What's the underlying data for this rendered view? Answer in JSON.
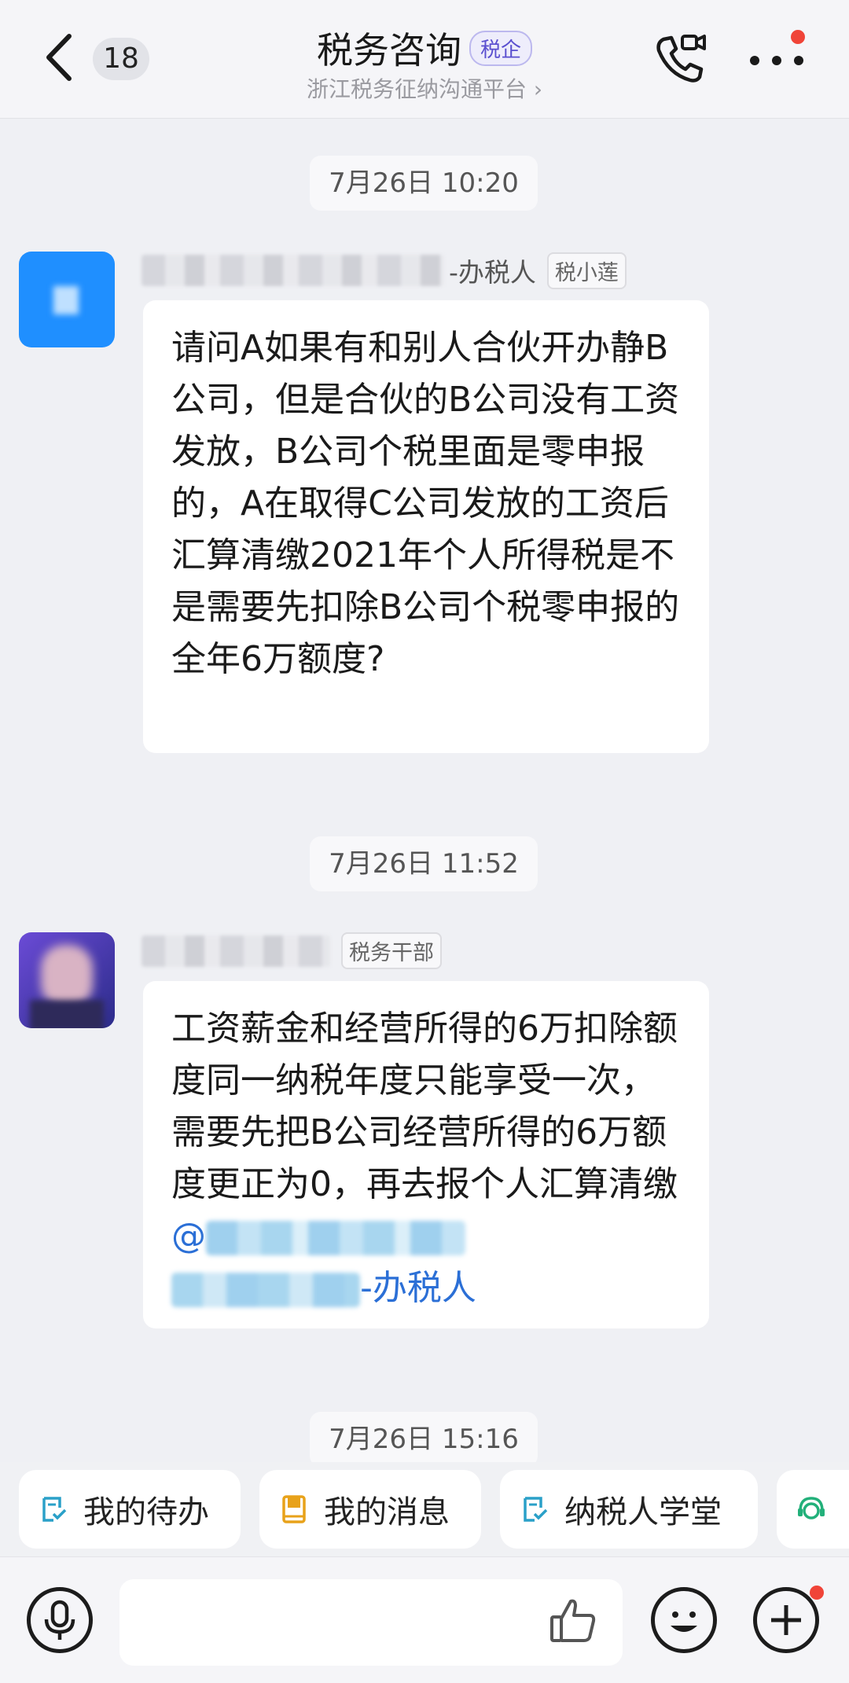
{
  "header": {
    "unread_count": "18",
    "title": "税务咨询",
    "title_badge": "税企",
    "subtitle": "浙江税务征纳沟通平台 ›"
  },
  "messages": [
    {
      "time": "7月26日 10:20",
      "sender_suffix": "-办税人",
      "role_tag": "税小莲",
      "text": "请问A如果有和别人合伙开办静B公司，但是合伙的B公司没有工资发放，B公司个税里面是零申报的，A在取得C公司发放的工资后汇算清缴2021年个人所得税是不是需要先扣除B公司个税零申报的全年6万额度?"
    },
    {
      "time": "7月26日 11:52",
      "sender_suffix": "",
      "role_tag": "税务干部",
      "text": "工资薪金和经营所得的6万扣除额度同一纳税年度只能享受一次，需要先把B公司经营所得的6万额度更正为0，再去报个人汇算清缴",
      "mention_prefix": "@",
      "mention_suffix": "-办税人"
    },
    {
      "time": "7月26日 15:16"
    }
  ],
  "quick_actions": [
    {
      "label": "我的待办",
      "icon": "todo-icon"
    },
    {
      "label": "我的消息",
      "icon": "message-book-icon"
    },
    {
      "label": "纳税人学堂",
      "icon": "school-icon"
    },
    {
      "label": "",
      "icon": "service-icon"
    }
  ],
  "input": {
    "placeholder": ""
  },
  "colors": {
    "accent": "#5a4fcf",
    "mention": "#2b6fd6",
    "notify": "#f04438",
    "avatar_blue": "#1f8fff"
  }
}
